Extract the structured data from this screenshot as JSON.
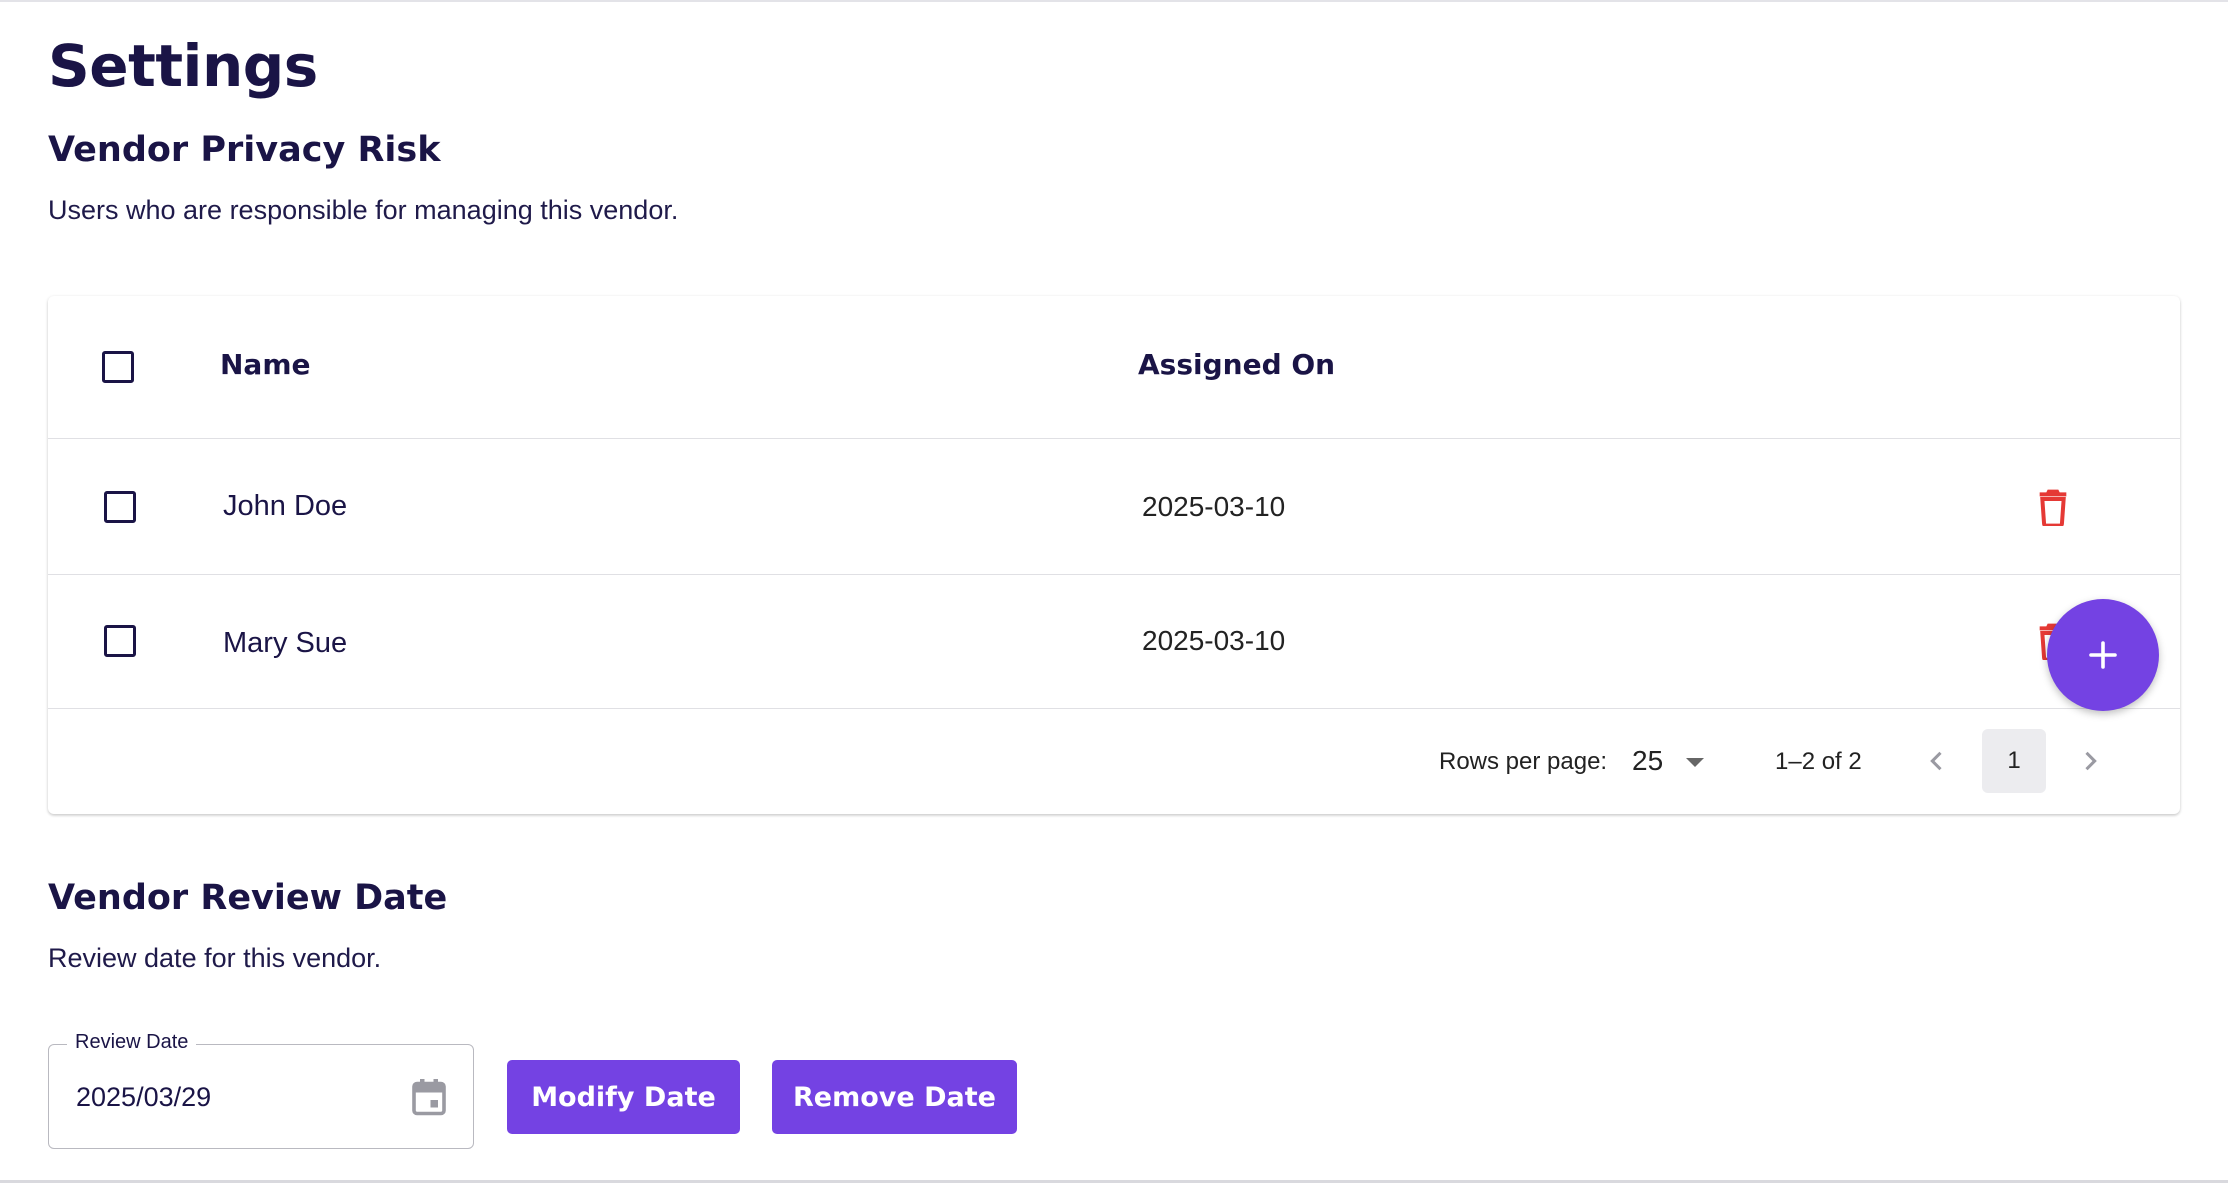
{
  "page": {
    "title": "Settings"
  },
  "privacy_risk": {
    "title": "Vendor Privacy Risk",
    "description": "Users who are responsible for managing this vendor.",
    "table": {
      "columns": [
        "Name",
        "Assigned On"
      ],
      "rows": [
        {
          "name": "John Doe",
          "assigned_on": "2025-03-10"
        },
        {
          "name": "Mary Sue",
          "assigned_on": "2025-03-10"
        }
      ],
      "pagination": {
        "rows_per_page_label": "Rows per page:",
        "rows_per_page_value": "25",
        "range_text": "1–2 of 2",
        "current_page": "1"
      }
    }
  },
  "review_date": {
    "title": "Vendor Review Date",
    "description": "Review date for this vendor.",
    "field_label": "Review Date",
    "field_value": "2025/03/29",
    "modify_label": "Modify Date",
    "remove_label": "Remove Date"
  },
  "colors": {
    "accent": "#7442e3",
    "text": "#1a1446",
    "delete": "#e53935"
  },
  "icons": {
    "delete": "trash-icon",
    "add": "plus-icon",
    "calendar": "calendar-icon",
    "prev": "chevron-left-icon",
    "next": "chevron-right-icon",
    "dropdown": "caret-down-icon"
  }
}
